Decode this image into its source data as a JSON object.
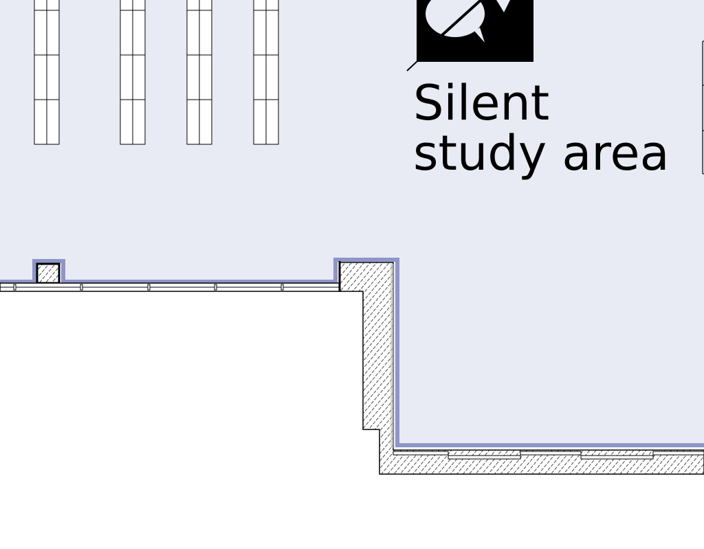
{
  "area_label": {
    "line1": "Silent",
    "line2": "study area"
  },
  "icons": {
    "silent_zone": "no-talking-speech-bubbles-icon"
  },
  "colors": {
    "room_fill": "#e8eaf4",
    "room_outline": "#8e95c8",
    "wall": "#000000",
    "background": "#ffffff"
  }
}
